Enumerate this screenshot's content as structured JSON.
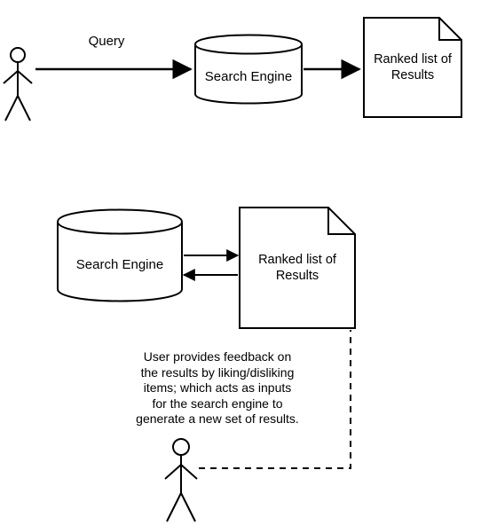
{
  "top": {
    "query_label": "Query",
    "engine_label": "Search Engine",
    "results_label": "Ranked list of\nResults"
  },
  "bottom": {
    "engine_label": "Search Engine",
    "results_label": "Ranked list of\nResults",
    "feedback_text": "User provides feedback on\nthe results by liking/disliking\nitems; which acts as inputs\nfor the search engine to\ngenerate a new set of results."
  }
}
